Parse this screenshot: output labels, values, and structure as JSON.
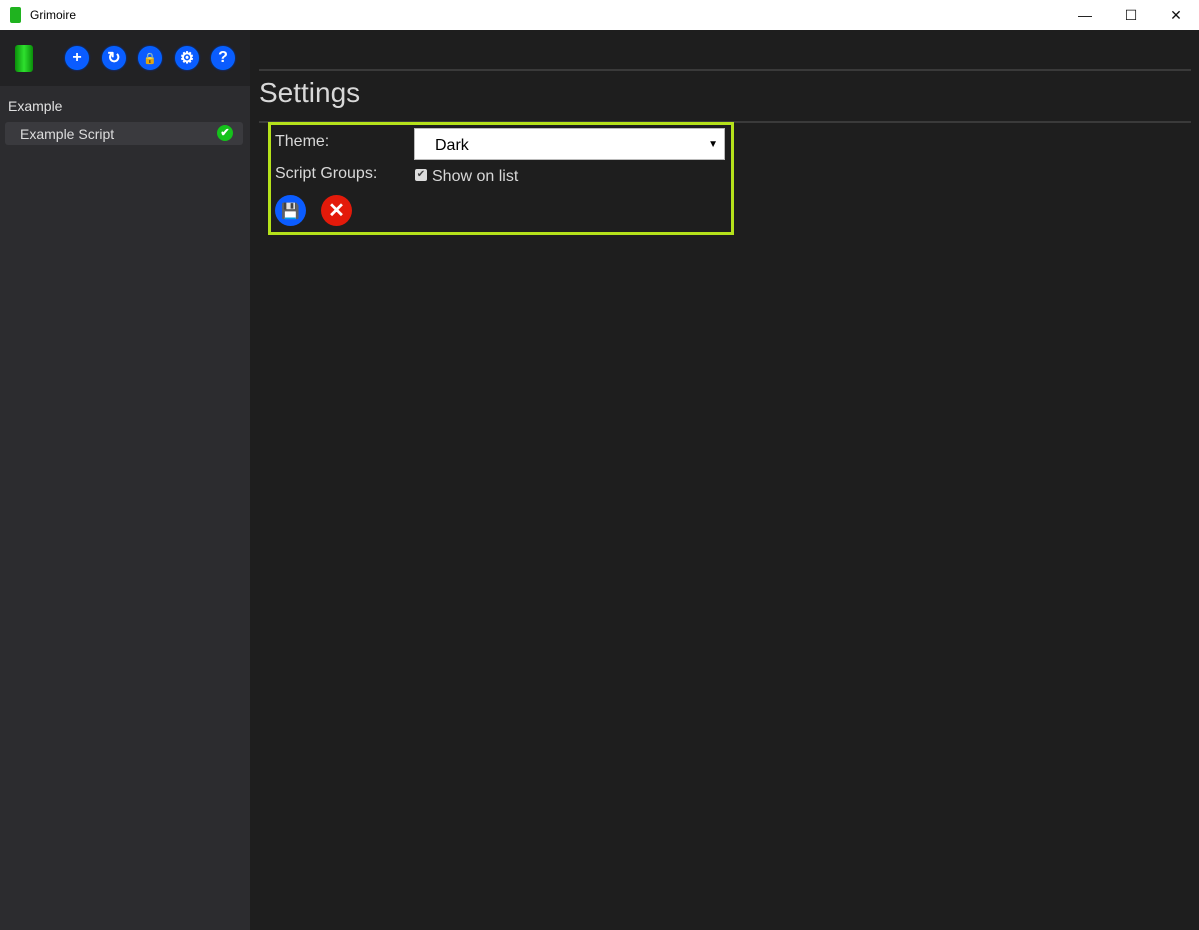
{
  "window": {
    "title": "Grimoire",
    "minimize": "—",
    "maximize": "☐",
    "close": "✕"
  },
  "toolbar": {
    "add": "+",
    "reload": "↻",
    "lock": "🔒",
    "settings": "⚙",
    "help": "?"
  },
  "sidebar": {
    "group": "Example",
    "scripts": [
      {
        "label": "Example Script",
        "status": "ok",
        "status_glyph": "✔"
      }
    ]
  },
  "settings": {
    "title": "Settings",
    "theme_label": "Theme:",
    "theme_value": "Dark",
    "groups_label": "Script Groups:",
    "show_on_list_label": "Show on list",
    "show_on_list_checked": true,
    "save_glyph": "💾",
    "cancel_glyph": "✕"
  },
  "colors": {
    "accent": "#0b5cff",
    "highlight": "#b5e21b",
    "success": "#15c21b",
    "danger": "#e31a0a"
  }
}
